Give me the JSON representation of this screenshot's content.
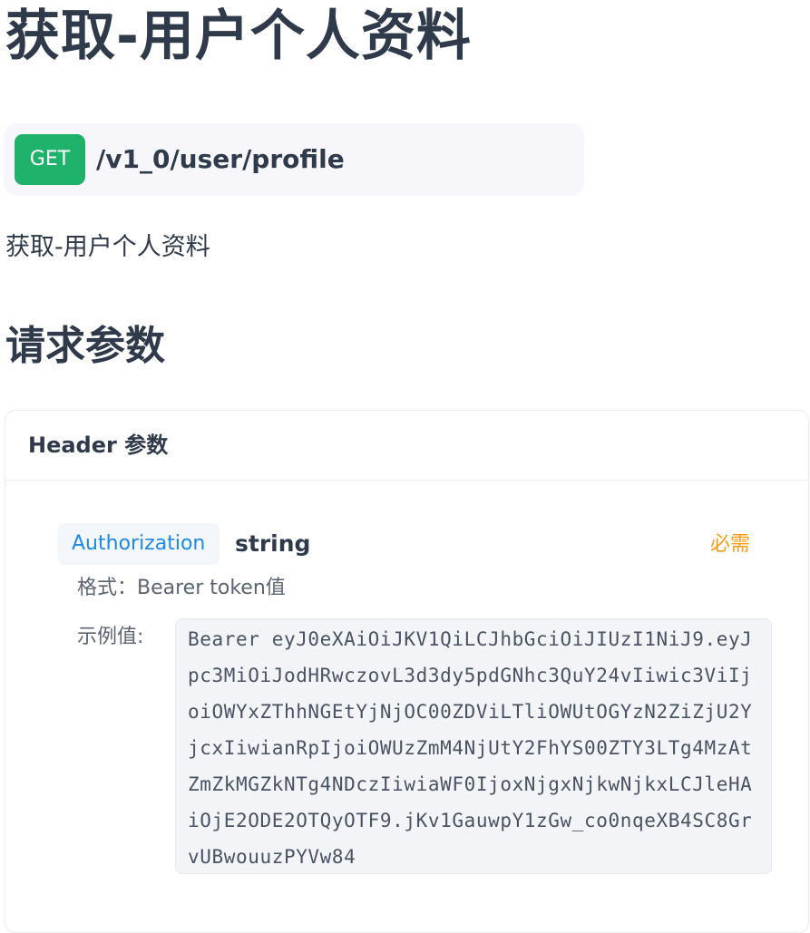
{
  "page": {
    "title": "获取-用户个人资料",
    "description": "获取-用户个人资料"
  },
  "endpoint": {
    "method": "GET",
    "path": "/v1_0/user/profile",
    "method_color": "#1eb26a"
  },
  "request_params": {
    "section_title": "请求参数",
    "header_card": {
      "label": "Header 参数",
      "params": [
        {
          "name": "Authorization",
          "type": "string",
          "required_label": "必需",
          "format": "格式：Bearer token值",
          "example_label": "示例值:",
          "example_lines": [
            "Bearer eyJ0eXAiOiJKV1QiLCJhbGciOiJIUzI1NiJ9.eyJ",
            "pc3MiOiJodHRwczovL3d3dy5pdGNhc3QuY24vIiwic3ViIj",
            "oiOWYxZThhNGEtYjNjOC00ZDViLTliOWUtOGYzN2ZiZjU2Y",
            "jcxIiwianRpIjoiOWUzZmM4NjUtY2FhYS00ZTY3LTg4MzAt",
            "ZmZkMGZkNTg4NDczIiwiaWF0IjoxNjgxNjkwNjkxLCJleHA",
            "iOjE2ODE2OTQyOTF9.jKv1GauwpY1zGw_co0nqeXB4SC8Gr",
            "vUBwouuzPYVw84"
          ]
        }
      ]
    }
  },
  "colors": {
    "required": "#f39c12",
    "param_name": "#1e88e5",
    "text": "#2f3a4a"
  }
}
